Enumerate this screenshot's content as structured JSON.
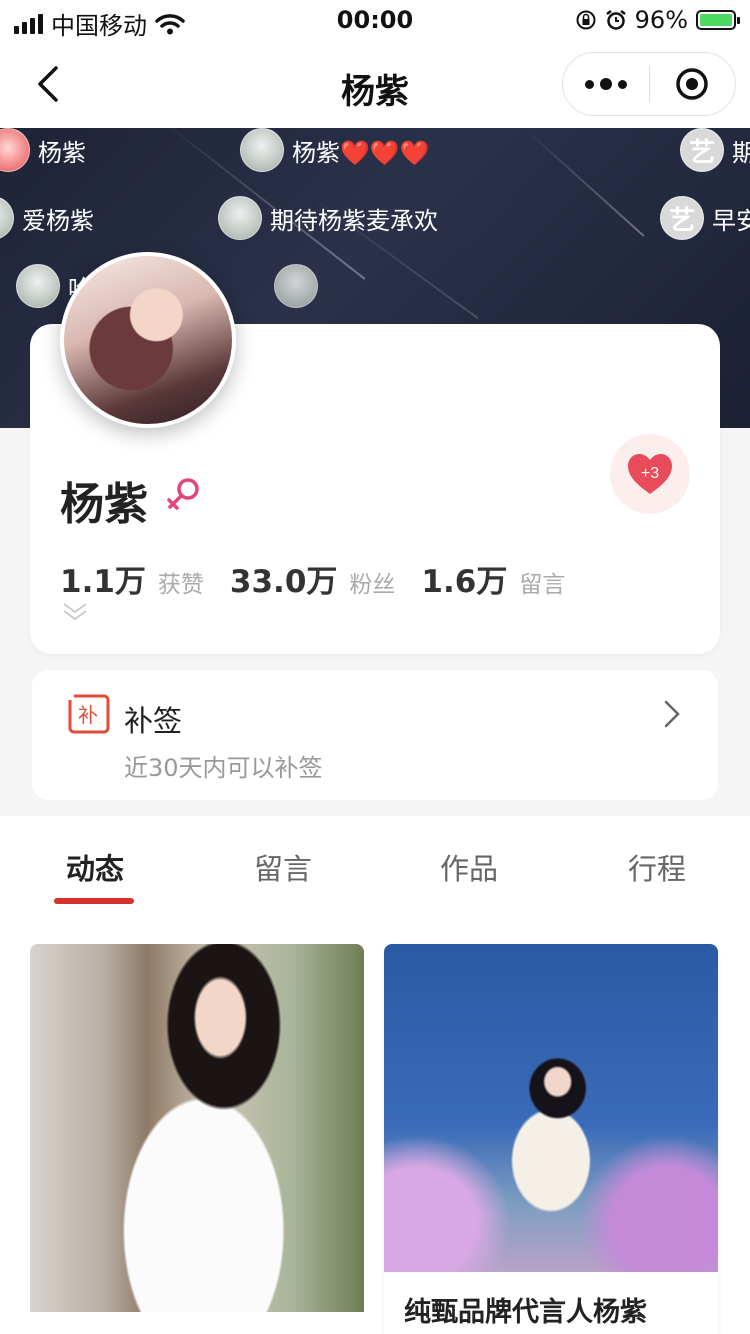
{
  "status_bar": {
    "carrier": "中国移动",
    "time": "00:00",
    "battery": "96%"
  },
  "nav": {
    "title": "杨紫"
  },
  "danmu": [
    {
      "text": "杨紫",
      "avatar": "pink"
    },
    {
      "text": "杨紫❤️❤️❤️",
      "avatar": "default"
    },
    {
      "text": "期",
      "avatar": "yi"
    },
    {
      "text": "爱杨紫",
      "avatar": "default"
    },
    {
      "text": "期待杨紫麦承欢",
      "avatar": "default"
    },
    {
      "text": "早安",
      "avatar": "yi"
    },
    {
      "text": "哈!",
      "avatar": "default"
    },
    {
      "text": "",
      "avatar": "default"
    }
  ],
  "danmu_avatar_glyph": "艺",
  "profile": {
    "name": "杨紫",
    "gender": "female",
    "like_badge": "+3",
    "stats": [
      {
        "value": "1.1万",
        "label": "获赞"
      },
      {
        "value": "33.0万",
        "label": "粉丝"
      },
      {
        "value": "1.6万",
        "label": "留言"
      }
    ]
  },
  "sign": {
    "icon_glyph": "补",
    "title": "补签",
    "subtitle": "近30天内可以补签"
  },
  "tabs": [
    {
      "label": "动态",
      "active": true
    },
    {
      "label": "留言",
      "active": false
    },
    {
      "label": "作品",
      "active": false
    },
    {
      "label": "行程",
      "active": false
    }
  ],
  "posts": [
    {
      "caption": ""
    },
    {
      "caption": "纯甄品牌代言人杨紫"
    }
  ],
  "colors": {
    "accent": "#d5322c",
    "banner_bg": "#222839",
    "gender_female": "#e2457a",
    "heart": "#e84b5a"
  }
}
